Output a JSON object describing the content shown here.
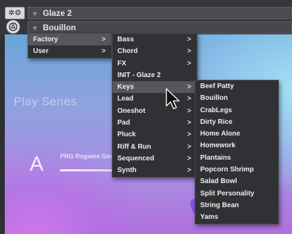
{
  "header": {
    "preset_bar_title": "Glaze 2",
    "bank_bar_title": "Bouillon",
    "gear_button_icon": "gear-icon",
    "power_button_icon": "power-icon"
  },
  "art": {
    "brand_text": "Play Series",
    "big_letter": "A",
    "preset_label": "PRG Rogains Gmin"
  },
  "menu_level1": {
    "items": [
      {
        "label": "Factory",
        "has_submenu": true,
        "selected": true
      },
      {
        "label": "User",
        "has_submenu": true,
        "selected": false
      }
    ]
  },
  "menu_level2": {
    "items": [
      {
        "label": "Bass",
        "has_submenu": true
      },
      {
        "label": "Chord",
        "has_submenu": true
      },
      {
        "label": "FX",
        "has_submenu": true
      },
      {
        "label": "INIT - Glaze 2",
        "has_submenu": false
      },
      {
        "label": "Keys",
        "has_submenu": true,
        "selected": true
      },
      {
        "label": "Lead",
        "has_submenu": true
      },
      {
        "label": "Oneshot",
        "has_submenu": true
      },
      {
        "label": "Pad",
        "has_submenu": true
      },
      {
        "label": "Pluck",
        "has_submenu": true
      },
      {
        "label": "Riff & Run",
        "has_submenu": true
      },
      {
        "label": "Sequenced",
        "has_submenu": true
      },
      {
        "label": "Synth",
        "has_submenu": true
      }
    ]
  },
  "menu_level3": {
    "items": [
      {
        "label": "Beef Patty"
      },
      {
        "label": "Bouillon"
      },
      {
        "label": "CrabLegs"
      },
      {
        "label": "Dirty Rice"
      },
      {
        "label": "Home Alone"
      },
      {
        "label": "Homework"
      },
      {
        "label": "Plantains"
      },
      {
        "label": "Popcorn Shrimp"
      },
      {
        "label": "Salad Bowl"
      },
      {
        "label": "Split Personality"
      },
      {
        "label": "String Bean"
      },
      {
        "label": "Yams"
      }
    ]
  },
  "glyphs": {
    "chevron": "▾",
    "submenu_arrow": ">"
  }
}
